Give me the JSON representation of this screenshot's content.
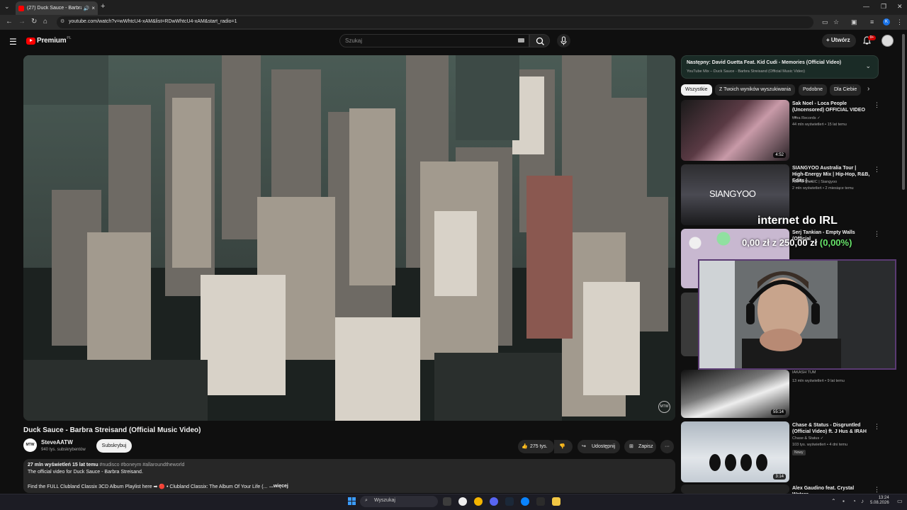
{
  "browser": {
    "tab_title": "(27) Duck Sauce - Barbra St",
    "url": "youtube.com/watch?v=wWhtcU4-xAM&list=RDwWhtcU4-xAM&start_radio=1",
    "profile_letter": "K"
  },
  "header": {
    "brand": "Premium",
    "region": "PL",
    "search_placeholder": "Szukaj",
    "create_label": "Utwórz",
    "notif_count": "9+"
  },
  "video": {
    "title": "Duck Sauce - Barbra Streisand (Official Music Video)",
    "watermark": "MTW",
    "channel": {
      "avatar_text": "MTW",
      "name": "SteveAATW",
      "subs": "940 tys. subskrybentów",
      "subscribe_label": "Subskrybuj"
    },
    "actions": {
      "likes": "275 tys.",
      "share": "Udostępnij",
      "save": "Zapisz"
    },
    "description": {
      "meta": "27 mln wyświetleń  15 lat temu",
      "tags": "#nudisco #boneym #allaroundtheworld",
      "line1": "The official video for Duck Sauce - Barbra Streisand.",
      "line2": "Find the FULL Clubland Classix 3CD Album Playlist here ➡ 🔴 • Clubland Classix: The Album Of Your Life (...",
      "more": "...więcej"
    }
  },
  "upnext": {
    "title": "Następny: David Guetta Feat. Kid Cudi - Memories (Official Video)",
    "subtitle": "YouTube Mix – Duck Sauce - Barbra Streisand (Official Music Video)"
  },
  "chips": [
    "Wszystkie",
    "Z Twoich wyników wyszukiwania",
    "Podobne",
    "Dla Ciebie"
  ],
  "recs": [
    {
      "title": "Sak Noel - Loca People (Uncensored) OFFICIAL VIDEO ...",
      "channel": "Ultra Records ✓",
      "meta": "44 mln wyświetleń • 15 lat temu",
      "duration": "4:52"
    },
    {
      "title": "SIANGYOO Australia Tour | High-Energy Mix | Hip-Hop, R&B, Edits | ...",
      "channel": "AMPM MUSIC | Siangyoo",
      "meta": "2 mln wyświetleń • 2 miesiące temu",
      "overlay": "SIANGYOO"
    },
    {
      "title": "Serj Tankian - Empty Walls (Official",
      "channel": "",
      "meta": ""
    },
    {
      "title": "",
      "channel": "IAKASH TUM",
      "meta": "13 mln wyświetleń • 9 lat temu",
      "duration": "55:14"
    },
    {
      "title": "Chase & Status - Disgruntled (Official Video) ft. J Hus & IRAH",
      "channel": "Chase & Status ✓",
      "meta": "103 tys. wyświetleń • 4 dni temu",
      "badge": "Nowy",
      "duration": "3:14"
    },
    {
      "title": "Alex Gaudino feat. Crystal Waters -",
      "channel": "",
      "meta": ""
    }
  ],
  "overlay": {
    "title": "internet do IRL",
    "goal_current": "0,00 zł",
    "goal_sep": "z",
    "goal_target": "250,00 zł",
    "goal_pct": "(0,00%)"
  },
  "taskbar": {
    "search_label": "Wyszukaj",
    "time": "13:24",
    "date": "5.08.2026"
  }
}
